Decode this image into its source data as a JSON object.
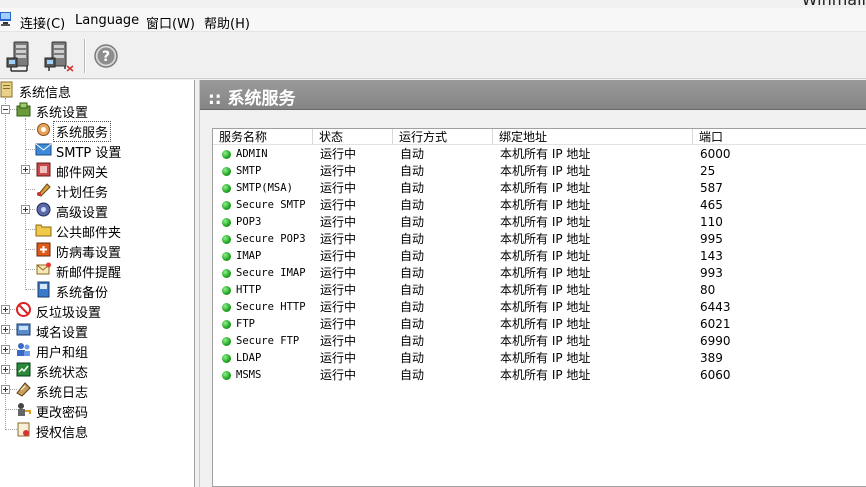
{
  "window": {
    "title": "Winmail"
  },
  "menu": [
    "连接(C)",
    "Language",
    "窗口(W)",
    "帮助(H)"
  ],
  "toolbar": {
    "buttons": [
      {
        "name": "connect-server-button",
        "icon": "server-connect-icon"
      },
      {
        "name": "disconnect-server-button",
        "icon": "server-disconnect-icon"
      },
      {
        "name": "help-button",
        "icon": "help-icon"
      }
    ]
  },
  "tree": {
    "root": "系统信息",
    "settings": "系统设置",
    "settings_children": [
      "系统服务",
      "SMTP 设置",
      "邮件网关",
      "计划任务",
      "高级设置",
      "公共邮件夹",
      "防病毒设置",
      "新邮件提醒",
      "系统备份"
    ],
    "others": [
      "反垃圾设置",
      "域名设置",
      "用户和组",
      "系统状态",
      "系统日志",
      "更改密码",
      "授权信息"
    ]
  },
  "content": {
    "title": ":: 系统服务",
    "columns": [
      "服务名称",
      "状态",
      "运行方式",
      "绑定地址",
      "端口"
    ],
    "rows": [
      {
        "name": "ADMIN",
        "status": "运行中",
        "mode": "自动",
        "bind": "本机所有 IP 地址",
        "port": "6000"
      },
      {
        "name": "SMTP",
        "status": "运行中",
        "mode": "自动",
        "bind": "本机所有 IP 地址",
        "port": "25"
      },
      {
        "name": "SMTP(MSA)",
        "status": "运行中",
        "mode": "自动",
        "bind": "本机所有 IP 地址",
        "port": "587"
      },
      {
        "name": "Secure SMTP",
        "status": "运行中",
        "mode": "自动",
        "bind": "本机所有 IP 地址",
        "port": "465"
      },
      {
        "name": "POP3",
        "status": "运行中",
        "mode": "自动",
        "bind": "本机所有 IP 地址",
        "port": "110"
      },
      {
        "name": "Secure POP3",
        "status": "运行中",
        "mode": "自动",
        "bind": "本机所有 IP 地址",
        "port": "995"
      },
      {
        "name": "IMAP",
        "status": "运行中",
        "mode": "自动",
        "bind": "本机所有 IP 地址",
        "port": "143"
      },
      {
        "name": "Secure IMAP",
        "status": "运行中",
        "mode": "自动",
        "bind": "本机所有 IP 地址",
        "port": "993"
      },
      {
        "name": "HTTP",
        "status": "运行中",
        "mode": "自动",
        "bind": "本机所有 IP 地址",
        "port": "80"
      },
      {
        "name": "Secure HTTP",
        "status": "运行中",
        "mode": "自动",
        "bind": "本机所有 IP 地址",
        "port": "6443"
      },
      {
        "name": "FTP",
        "status": "运行中",
        "mode": "自动",
        "bind": "本机所有 IP 地址",
        "port": "6021"
      },
      {
        "name": "Secure FTP",
        "status": "运行中",
        "mode": "自动",
        "bind": "本机所有 IP 地址",
        "port": "6990"
      },
      {
        "name": "LDAP",
        "status": "运行中",
        "mode": "自动",
        "bind": "本机所有 IP 地址",
        "port": "389"
      },
      {
        "name": "MSMS",
        "status": "运行中",
        "mode": "自动",
        "bind": "本机所有 IP 地址",
        "port": "6060"
      }
    ]
  },
  "colors": {
    "running": "#1fa21f",
    "banner": "#8e8e8e",
    "background": "#f0f0f0"
  }
}
